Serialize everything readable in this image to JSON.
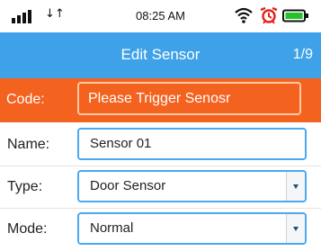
{
  "status_bar": {
    "time": "08:25 AM",
    "data_arrows": "↓↑",
    "icons": [
      "signal-bars-icon",
      "data-transfer-icon",
      "wifi-icon",
      "alarm-clock-icon",
      "battery-icon"
    ],
    "battery_level": 1.0
  },
  "header": {
    "title": "Edit Sensor",
    "page_indicator": "1/9",
    "color": "#3fa2e8"
  },
  "code": {
    "label": "Code:",
    "value": "Please Trigger Senosr",
    "color": "#f3621f"
  },
  "form": {
    "name": {
      "label": "Name:",
      "value": "Sensor 01"
    },
    "type": {
      "label": "Type:",
      "value": "Door Sensor"
    },
    "mode": {
      "label": "Mode:",
      "value": "Normal"
    }
  },
  "accent_color": "#4aa9ee"
}
